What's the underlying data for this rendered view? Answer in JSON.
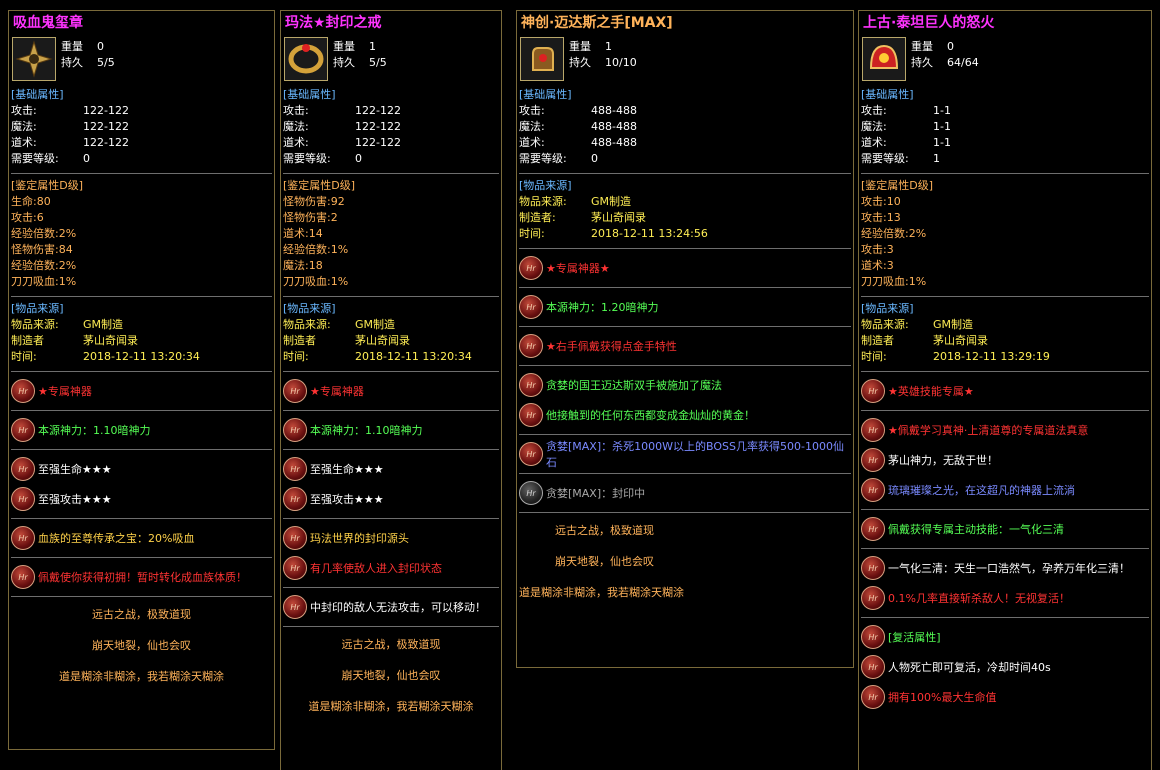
{
  "panels": [
    {
      "title": "吸血鬼玺章",
      "title_color": "#ff33ff",
      "weight_label": "重量",
      "weight": "0",
      "dur_label": "持久",
      "dur": "5/5",
      "base_hdr": "[基础属性]",
      "base": [
        [
          "攻击:",
          "122-122"
        ],
        [
          "魔法:",
          "122-122"
        ],
        [
          "道术:",
          "122-122"
        ],
        [
          "需要等级:",
          "0"
        ]
      ],
      "ident_hdr": "[鉴定属性D级]",
      "ident": [
        "生命:80",
        "攻击:6",
        "经验倍数:2%",
        "怪物伤害:84",
        "经验倍数:2%",
        "刀刀吸血:1%"
      ],
      "src_hdr": "[物品来源]",
      "src": [
        [
          "物品来源:",
          "GM制造"
        ],
        [
          "制造者",
          "茅山奇闻录"
        ],
        [
          "时间:",
          "2018-12-11 13:20:34"
        ]
      ],
      "skills": [
        [
          "★专属神器",
          "red"
        ],
        [
          "本源神力：1.10暗神力",
          "green"
        ],
        [
          "至强生命★★★",
          "white"
        ],
        [
          "至强攻击★★★",
          "white"
        ],
        [
          "血族的至尊传承之宝：20%吸血",
          "gold"
        ],
        [
          "佩戴使你获得初拥！暂时转化成血族体质！",
          "red"
        ]
      ],
      "footer": [
        "远古之战，极致道现",
        "崩天地裂，仙也会叹",
        "道是糊涂非糊涂，我若糊涂天糊涂"
      ]
    },
    {
      "title": "玛法★封印之戒",
      "title_color": "#ff33ff",
      "weight_label": "重量",
      "weight": "1",
      "dur_label": "持久",
      "dur": "5/5",
      "base_hdr": "[基础属性]",
      "base": [
        [
          "攻击:",
          "122-122"
        ],
        [
          "魔法:",
          "122-122"
        ],
        [
          "道术:",
          "122-122"
        ],
        [
          "需要等级:",
          "0"
        ]
      ],
      "ident_hdr": "[鉴定属性D级]",
      "ident": [
        "怪物伤害:92",
        "怪物伤害:2",
        "道术:14",
        "经验倍数:1%",
        "魔法:18",
        "刀刀吸血:1%"
      ],
      "src_hdr": "[物品来源]",
      "src": [
        [
          "物品来源:",
          "GM制造"
        ],
        [
          "制造者",
          "茅山奇闻录"
        ],
        [
          "时间:",
          "2018-12-11 13:20:34"
        ]
      ],
      "skills": [
        [
          "★专属神器",
          "red"
        ],
        [
          "本源神力：1.10暗神力",
          "green"
        ],
        [
          "至强生命★★★",
          "white"
        ],
        [
          "至强攻击★★★",
          "white"
        ],
        [
          "玛法世界的封印源头",
          "gold"
        ],
        [
          "有几率使敌人进入封印状态",
          "red"
        ],
        [
          "中封印的敌人无法攻击，可以移动！",
          "white"
        ]
      ],
      "footer": [
        "远古之战，极致道现",
        "崩天地裂，仙也会叹",
        "道是糊涂非糊涂，我若糊涂天糊涂"
      ]
    },
    {
      "title": "神创·迈达斯之手[MAX]",
      "title_color": "#ffb35a",
      "weight_label": "重量",
      "weight": "1",
      "dur_label": "持久",
      "dur": "10/10",
      "base_hdr": "[基础属性]",
      "base": [
        [
          "攻击:",
          "488-488"
        ],
        [
          "魔法:",
          "488-488"
        ],
        [
          "道术:",
          "488-488"
        ],
        [
          "需要等级:",
          "0"
        ]
      ],
      "src_hdr": "[物品来源]",
      "src": [
        [
          "物品来源:",
          "GM制造"
        ],
        [
          "制造者:",
          "茅山奇闻录"
        ],
        [
          "时间:",
          "2018-12-11 13:24:56"
        ]
      ],
      "skills": [
        [
          "★专属神器★",
          "red"
        ],
        [
          "本源神力：1.20暗神力",
          "green"
        ],
        [
          "★右手佩戴获得点金手特性",
          "red"
        ],
        [
          "贪婪的国王迈达斯双手被施加了魔法",
          "green"
        ],
        [
          "他接触到的任何东西都变成金灿灿的黄金！",
          "green"
        ],
        [
          "贪婪[MAX]：杀死1000W以上的BOSS几率获得500-1000仙石",
          "blue"
        ],
        [
          "贪婪[MAX]：封印中",
          "gray"
        ]
      ],
      "footer": [
        "远古之战，极致道现",
        "崩天地裂，仙也会叹",
        "道是糊涂非糊涂，我若糊涂天糊涂"
      ]
    },
    {
      "title": "上古·泰坦巨人的怒火",
      "title_color": "#ff33ff",
      "weight_label": "重量",
      "weight": "0",
      "dur_label": "持久",
      "dur": "64/64",
      "base_hdr": "[基础属性]",
      "base": [
        [
          "攻击:",
          "1-1"
        ],
        [
          "魔法:",
          "1-1"
        ],
        [
          "道术:",
          "1-1"
        ],
        [
          "需要等级:",
          "1"
        ]
      ],
      "ident_hdr": "[鉴定属性D级]",
      "ident": [
        "攻击:10",
        "攻击:13",
        "经验倍数:2%",
        "攻击:3",
        "道术:3",
        "刀刀吸血:1%"
      ],
      "src_hdr": "[物品来源]",
      "src": [
        [
          "物品来源:",
          "GM制造"
        ],
        [
          "制造者",
          "茅山奇闻录"
        ],
        [
          "时间:",
          "2018-12-11 13:29:19"
        ]
      ],
      "skills": [
        [
          "★英雄技能专属★",
          "red"
        ],
        [
          "★佩戴学习真神·上清道尊的专属道法真意",
          "red"
        ],
        [
          "茅山神力，无敌于世！",
          "white"
        ],
        [
          "琉璃璀璨之光，在这超凡的神器上流淌",
          "blue"
        ],
        [
          "佩戴获得专属主动技能：一气化三清",
          "green"
        ],
        [
          "一气化三清：天生一口浩然气，孕养万年化三清！",
          "white"
        ],
        [
          "0.1%几率直接斩杀敌人！无视复活！",
          "red"
        ],
        [
          "[复活属性]",
          "green"
        ],
        [
          "人物死亡即可复活，冷却时间40s",
          "white"
        ],
        [
          "拥有100%最大生命值",
          "red"
        ]
      ]
    }
  ]
}
